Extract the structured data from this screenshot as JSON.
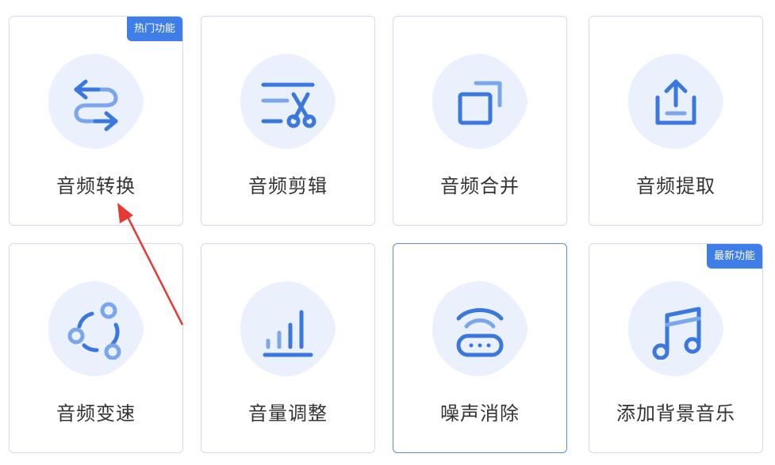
{
  "colors": {
    "accent": "#3f7ee8",
    "icon_primary": "#3a78e0",
    "icon_secondary": "#7aa6ee",
    "blob": "#eaf1fd",
    "annotation_arrow": "#e53935"
  },
  "cards": [
    {
      "label": "音频转换",
      "icon": "swap-arrows-icon",
      "badge": "热门功能"
    },
    {
      "label": "音频剪辑",
      "icon": "scissors-lines-icon"
    },
    {
      "label": "音频合并",
      "icon": "merge-squares-icon"
    },
    {
      "label": "音频提取",
      "icon": "upload-tray-icon"
    },
    {
      "label": "音频变速",
      "icon": "cycle-nodes-icon"
    },
    {
      "label": "音量调整",
      "icon": "volume-bars-icon"
    },
    {
      "label": "噪声消除",
      "icon": "router-wifi-icon",
      "selected": true
    },
    {
      "label": "添加背景音乐",
      "icon": "music-note-icon",
      "badge": "最新功能"
    }
  ]
}
